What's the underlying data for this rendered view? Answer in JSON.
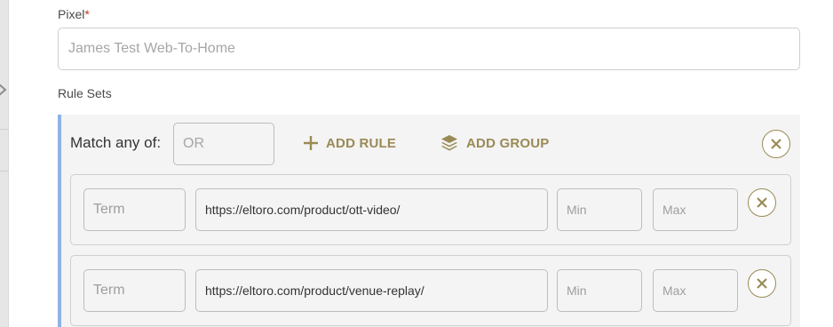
{
  "pixel": {
    "label": "Pixel",
    "required_marker": "*",
    "placeholder": "James Test Web-To-Home"
  },
  "rule_sets": {
    "label": "Rule Sets",
    "match_label": "Match any of:",
    "operator_placeholder": "OR",
    "add_rule_label": "ADD RULE",
    "add_group_label": "ADD GROUP",
    "rules": [
      {
        "term_placeholder": "Term",
        "url": "https://eltoro.com/product/ott-video/",
        "min_placeholder": "Min",
        "max_placeholder": "Max"
      },
      {
        "term_placeholder": "Term",
        "url": "https://eltoro.com/product/venue-replay/",
        "min_placeholder": "Min",
        "max_placeholder": "Max"
      }
    ]
  },
  "colors": {
    "accent": "#9a8a55",
    "group_border": "#8fb3e6",
    "required": "#c0392b"
  },
  "icons": {
    "add_rule": "plus-icon",
    "add_group": "layers-icon",
    "remove": "close-circle-icon",
    "collapse": "chevron-icon"
  }
}
